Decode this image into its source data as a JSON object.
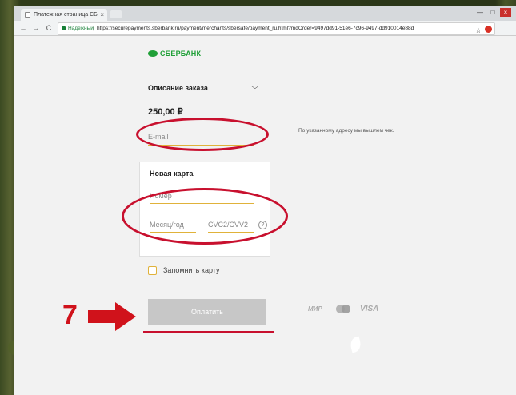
{
  "browser": {
    "tab_title": "Платежная страница СБ",
    "tab_close": "×",
    "window_controls": [
      "—",
      "□",
      "×"
    ],
    "nav": {
      "back": "←",
      "forward": "→",
      "reload": "C"
    },
    "secure_label": "Надежный",
    "url_separator": "|",
    "url": "https://securepayments.sberbank.ru/payment/merchants/sbersafe/payment_ru.html?mdOrder=9497dd91-51e6-7c96-9497-dd910014e88d",
    "star": "☆"
  },
  "page": {
    "logo_text": "СБЕРБАНК",
    "order_description": "Описание заказа",
    "chevron": "⌵",
    "amount": "250,00 ₽",
    "email_placeholder": "E-mail",
    "email_note": "По указанному адресу мы вышлем чек.",
    "card": {
      "title": "Новая карта",
      "number_placeholder": "Номер",
      "expiry_placeholder": "Месяц/год",
      "cvc_placeholder": "CVC2/CVV2",
      "help": "?"
    },
    "remember_label": "Запомнить карту",
    "pay_button": "Оплатить",
    "payment_systems": {
      "mir": "МИР",
      "visa": "VISA"
    }
  },
  "annotation": {
    "step_number": "7",
    "color": "#d0121b"
  },
  "colors": {
    "brand": "#21a038",
    "field_underline": "#e0b23a",
    "pay_button": "#c7c7c7",
    "annotation_red": "#c8102e"
  }
}
